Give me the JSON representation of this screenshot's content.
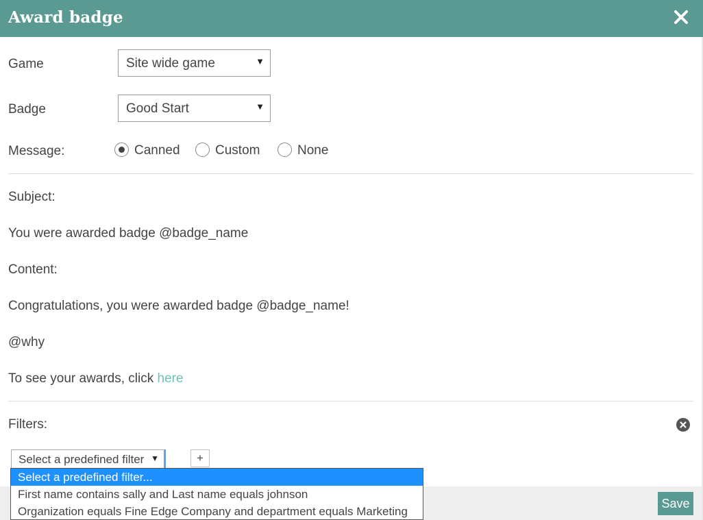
{
  "dialog": {
    "title": "Award badge"
  },
  "form": {
    "game_label": "Game",
    "game_value": "Site wide game",
    "badge_label": "Badge",
    "badge_value": "Good Start",
    "message_label": "Message:",
    "message_options": [
      {
        "label": "Canned",
        "selected": true
      },
      {
        "label": "Custom",
        "selected": false
      },
      {
        "label": "None",
        "selected": false
      }
    ]
  },
  "message": {
    "subject_label": "Subject:",
    "subject_text": "You were awarded badge @badge_name",
    "content_label": "Content:",
    "content_line1": "Congratulations, you were awarded badge @badge_name!",
    "content_line2": "@why",
    "content_line3_prefix": "To see your awards, click ",
    "content_line3_link": "here"
  },
  "filters": {
    "label": "Filters:",
    "select_value": "Select a predefined filter",
    "add_label": "+",
    "options": [
      "Select a predefined filter...",
      "First name contains sally and Last name equals johnson",
      "Organization equals Fine Edge Company and department equals Marketing"
    ]
  },
  "footer": {
    "save_label": "Save"
  },
  "colors": {
    "header": "#5a9a92",
    "link": "#6fc3b6",
    "option_highlight": "#1e90ff"
  },
  "icons": {
    "close": "close-icon",
    "clear_filters": "clear-circle-icon",
    "dropdown": "chevron-down-icon"
  }
}
